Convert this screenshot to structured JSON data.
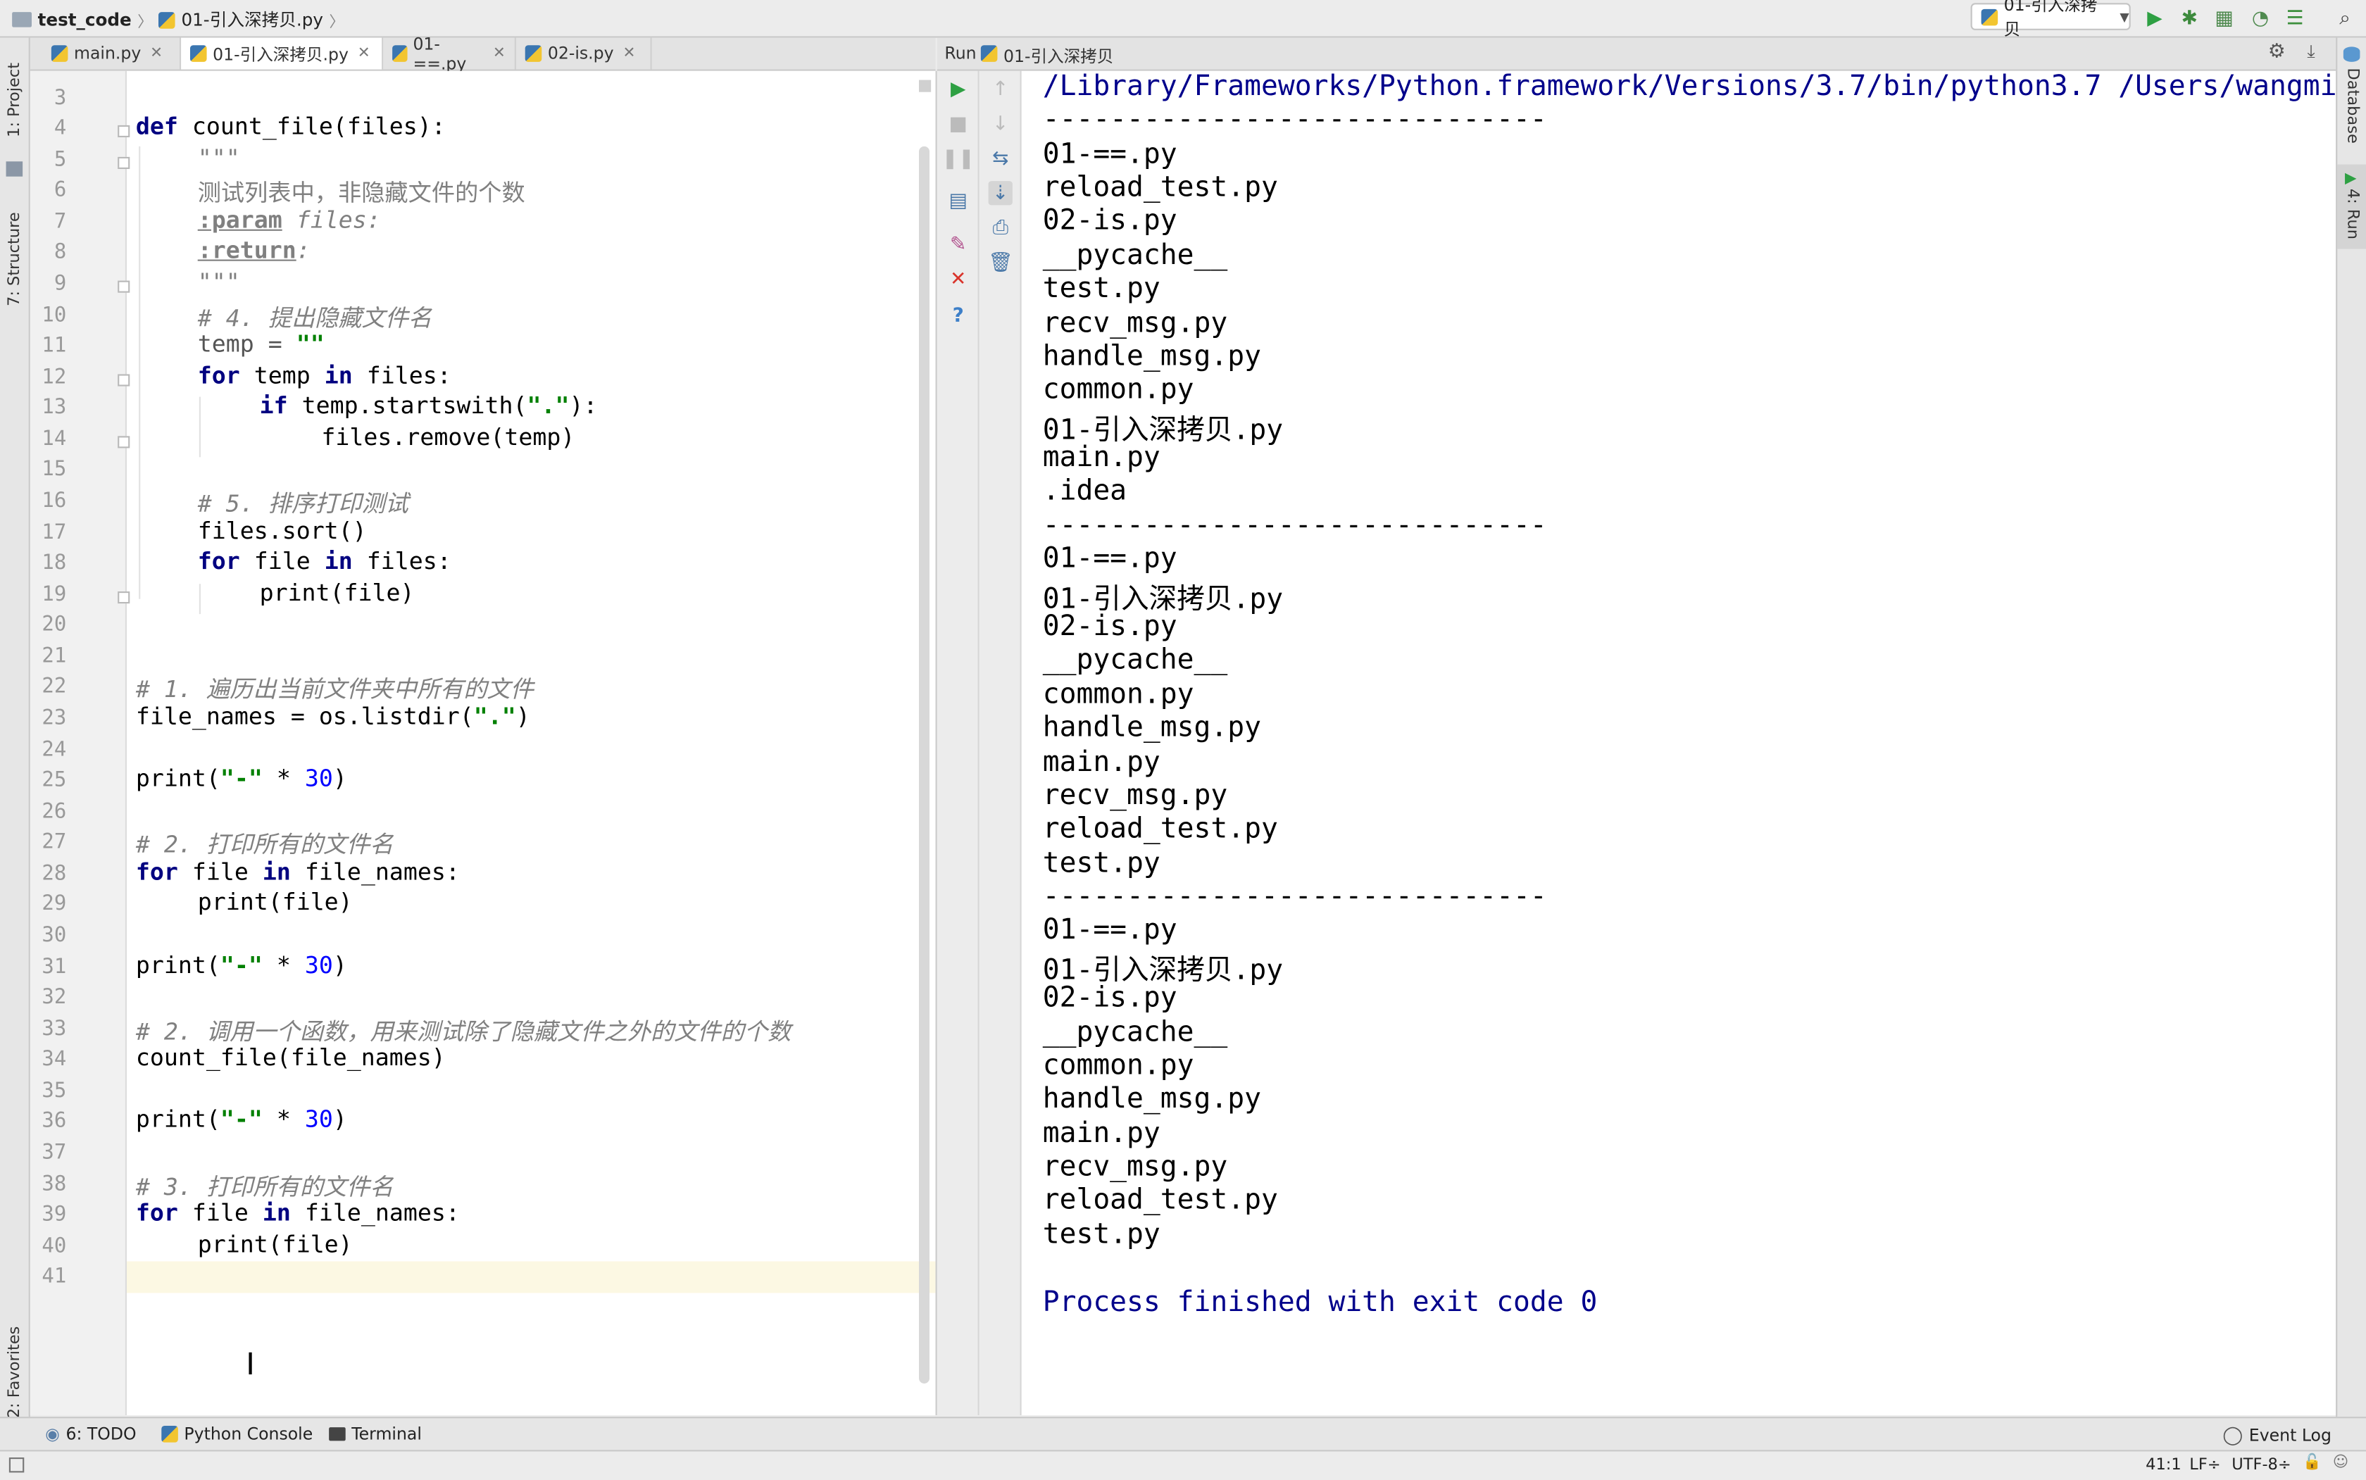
{
  "breadcrumb": {
    "project": "test_code",
    "file": "01-引入深拷贝.py"
  },
  "run_config": {
    "label": "01-引入深拷贝"
  },
  "left_strip": {
    "project": "1: Project",
    "structure": "7: Structure",
    "favorites": "2: Favorites"
  },
  "right_strip": {
    "database": "Database",
    "run": "4: Run"
  },
  "editor_tabs": [
    {
      "label": "main.py"
    },
    {
      "label": "01-引入深拷贝.py"
    },
    {
      "label": "01-==.py"
    },
    {
      "label": "02-is.py"
    }
  ],
  "run_panel": {
    "prefix": "Run",
    "title": "01-引入深拷贝"
  },
  "console": {
    "cmd": "/Library/Frameworks/Python.framework/Versions/3.7/bin/python3.7 /Users/wangmi",
    "sep": "------------------------------",
    "block1": [
      "01-==.py",
      "reload_test.py",
      "02-is.py",
      "__pycache__",
      "test.py",
      "recv_msg.py",
      "handle_msg.py",
      "common.py",
      "01-引入深拷贝.py",
      "main.py",
      ".idea"
    ],
    "block2": [
      "01-==.py",
      "01-引入深拷贝.py",
      "02-is.py",
      "__pycache__",
      "common.py",
      "handle_msg.py",
      "main.py",
      "recv_msg.py",
      "reload_test.py",
      "test.py"
    ],
    "block3": [
      "01-==.py",
      "01-引入深拷贝.py",
      "02-is.py",
      "__pycache__",
      "common.py",
      "handle_msg.py",
      "main.py",
      "recv_msg.py",
      "reload_test.py",
      "test.py"
    ],
    "exit": "Process finished with exit code 0"
  },
  "bottom_tools": {
    "todo": "6: TODO",
    "python_console": "Python Console",
    "terminal": "Terminal",
    "event_log": "Event Log"
  },
  "status": {
    "position": "41:1",
    "line_sep": "LF÷",
    "encoding": "UTF-8÷"
  },
  "code_lines": {
    "n3": "3",
    "n4": "4",
    "n5": "5",
    "n6": "6",
    "n7": "7",
    "n8": "8",
    "n9": "9",
    "n10": "10",
    "n11": "11",
    "n12": "12",
    "n13": "13",
    "n14": "14",
    "n15": "15",
    "n16": "16",
    "n17": "17",
    "n18": "18",
    "n19": "19",
    "n20": "20",
    "n21": "21",
    "n22": "22",
    "n23": "23",
    "n24": "24",
    "n25": "25",
    "n26": "26",
    "n27": "27",
    "n28": "28",
    "n29": "29",
    "n30": "30",
    "n31": "31",
    "n32": "32",
    "n33": "33",
    "n34": "34",
    "n35": "35",
    "n36": "36",
    "n37": "37",
    "n38": "38",
    "n39": "39",
    "n40": "40",
    "n41": "41"
  },
  "code": {
    "l4_kw": "def",
    "l4_rest": " count_file(files):",
    "l5": "\"\"\"",
    "l6": "测试列表中，非隐藏文件的个数",
    "l7_tag": ":param",
    "l7_val": " files:",
    "l8_tag": ":return",
    "l8_val": ":",
    "l9": "\"\"\"",
    "l10": "# 4. 提出隐藏文件名",
    "l11_a": "temp = ",
    "l11_s": "\"\"",
    "l12_kw": "for",
    "l12_b": " temp ",
    "l12_kw2": "in",
    "l12_c": " files:",
    "l13_kw": "if",
    "l13_b": " temp.startswith(",
    "l13_s": "\".\"",
    "l13_c": "):",
    "l14": "files.remove(temp)",
    "l16": "# 5. 排序打印测试",
    "l17": "files.sort()",
    "l18_kw": "for",
    "l18_b": " file ",
    "l18_kw2": "in",
    "l18_c": " files:",
    "l19": "print(file)",
    "l22": "# 1. 遍历出当前文件夹中所有的文件",
    "l23_a": "file_names = os.listdir(",
    "l23_s": "\".\"",
    "l23_c": ")",
    "l25_a": "print(",
    "l25_s": "\"-\"",
    "l25_b": " * ",
    "l25_n": "30",
    "l25_c": ")",
    "l27": "# 2. 打印所有的文件名",
    "l28_kw": "for",
    "l28_b": " file ",
    "l28_kw2": "in",
    "l28_c": " file_names:",
    "l29": "print(file)",
    "l31_a": "print(",
    "l31_s": "\"-\"",
    "l31_b": " * ",
    "l31_n": "30",
    "l31_c": ")",
    "l33": "# 2. 调用一个函数，用来测试除了隐藏文件之外的文件的个数",
    "l34": "count_file(file_names)",
    "l36_a": "print(",
    "l36_s": "\"-\"",
    "l36_b": " * ",
    "l36_n": "30",
    "l36_c": ")",
    "l38": "# 3. 打印所有的文件名",
    "l39_kw": "for",
    "l39_b": " file ",
    "l39_kw2": "in",
    "l39_c": " file_names:",
    "l40": "print(file)"
  }
}
